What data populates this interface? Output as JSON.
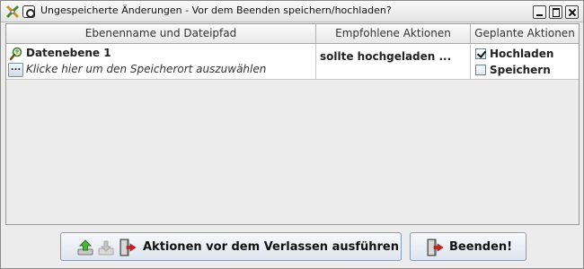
{
  "window": {
    "title": "Ungespeicherte Änderungen - Vor dem Beenden speichern/hochladen?"
  },
  "table": {
    "columns": [
      "Ebenenname und Dateipfad",
      "Empfohlene Aktionen",
      "Geplante Aktionen"
    ],
    "rows": [
      {
        "layer_name": "Datenebene 1",
        "browse_label": "...",
        "path_hint": "Klicke hier um den Speicherort auszuwählen",
        "recommended": "sollte hochgeladen ...",
        "actions": [
          {
            "label": "Hochladen",
            "checked": true
          },
          {
            "label": "Speichern",
            "checked": false
          }
        ]
      }
    ]
  },
  "buttons": {
    "run_label": "Aktionen vor dem Verlassen ausführen",
    "exit_label": "Beenden!"
  },
  "icons": {
    "app": "josm-app-icon",
    "system_menu": "system-menu-icon",
    "layer": "data-layer-icon",
    "upload": "upload-icon",
    "save": "save-icon",
    "exit": "exit-door-icon"
  },
  "colors": {
    "accent_green": "#3c9a2f",
    "exit_arrow_red": "#d42020",
    "button_border": "#8a9bb3"
  }
}
